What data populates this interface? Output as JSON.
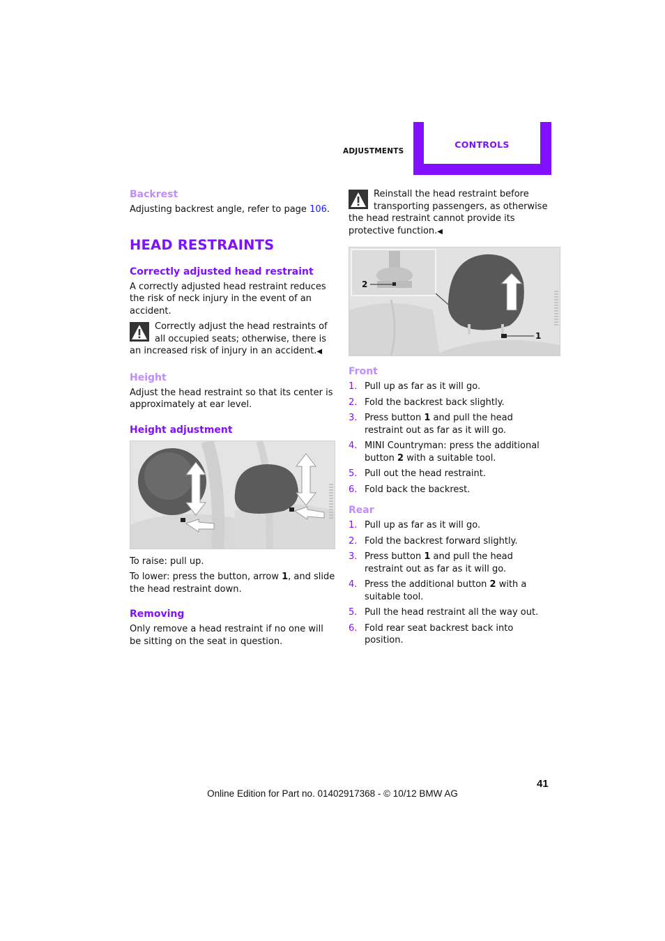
{
  "header": {
    "section": "ADJUSTMENTS",
    "tab": "CONTROLS",
    "accent_color": "#8010ff"
  },
  "left": {
    "backrest": {
      "heading": "Backrest",
      "text_before": "Adjusting backrest angle, refer to page ",
      "page_link": "106",
      "text_after": "."
    },
    "main_heading": "HEAD RESTRAINTS",
    "correct": {
      "heading": "Correctly adjusted head restraint",
      "text": "A correctly adjusted head restraint reduces the risk of neck injury in the event of an accident.",
      "warning": "Correctly adjust the head restraints of all occupied seats; otherwise, there is an increased risk of injury in an accident.",
      "warning_icon": "warning-triangle-icon",
      "end_mark": "◀"
    },
    "height": {
      "heading": "Height",
      "text": "Adjust the head restraint so that its center is approximately at ear level."
    },
    "height_adjustment": {
      "heading": "Height adjustment",
      "figure_alt": "Head restraints with up/down arrows and release button arrows",
      "raise": "To raise: pull up.",
      "lower_before": "To lower: press the button, arrow ",
      "lower_bold": "1",
      "lower_after": ", and slide the head restraint down."
    },
    "removing": {
      "heading": "Removing",
      "text": "Only remove a head restraint if no one will be sitting on the seat in question."
    }
  },
  "right": {
    "warning": "Reinstall the head restraint before transporting passengers, as otherwise the head restraint cannot provide its protective function.",
    "warning_icon": "warning-triangle-icon",
    "end_mark": "◀",
    "figure": {
      "callout_1": "1",
      "callout_2": "2"
    },
    "front": {
      "heading": "Front",
      "steps": [
        {
          "num": "1.",
          "parts": [
            "Pull up as far as it will go."
          ]
        },
        {
          "num": "2.",
          "parts": [
            "Fold the backrest back slightly."
          ]
        },
        {
          "num": "3.",
          "before": "Press button ",
          "bold": "1",
          "after": " and pull the head restraint out as far as it will go."
        },
        {
          "num": "4.",
          "before": "MINI Countryman: press the additional button ",
          "bold": "2",
          "after": " with a suitable tool."
        },
        {
          "num": "5.",
          "parts": [
            "Pull out the head restraint."
          ]
        },
        {
          "num": "6.",
          "parts": [
            "Fold back the backrest."
          ]
        }
      ]
    },
    "rear": {
      "heading": "Rear",
      "steps": [
        {
          "num": "1.",
          "parts": [
            "Pull up as far as it will go."
          ]
        },
        {
          "num": "2.",
          "parts": [
            "Fold the backrest forward slightly."
          ]
        },
        {
          "num": "3.",
          "before": "Press button ",
          "bold": "1",
          "after": " and pull the head restraint out as far as it will go."
        },
        {
          "num": "4.",
          "before": "Press the additional button ",
          "bold": "2",
          "after": " with a suitable tool."
        },
        {
          "num": "5.",
          "parts": [
            "Pull the head restraint all the way out."
          ]
        },
        {
          "num": "6.",
          "parts": [
            "Fold rear seat backrest back into position."
          ]
        }
      ]
    }
  },
  "footer": {
    "page_number": "41",
    "edition": "Online Edition for Part no. 01402917368 - © 10/12 BMW AG"
  }
}
